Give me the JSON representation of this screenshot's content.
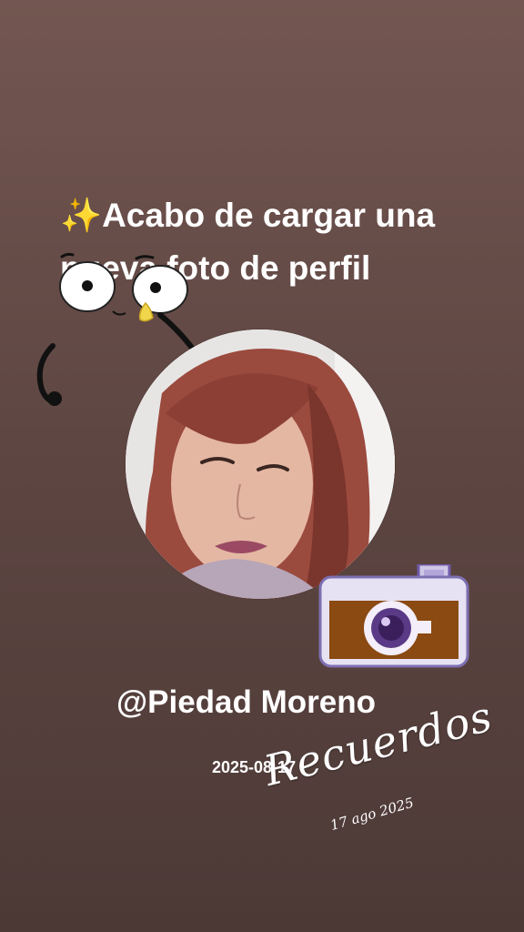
{
  "post": {
    "sparkle_icon": "sparkles-icon",
    "headline": "Acabo de cargar una nueva foto de perfil",
    "username": "@Piedad Moreno",
    "date": "2025-08-17"
  },
  "stickers": {
    "recuerdos": "Recuerdos",
    "sticker_date": "17 ago 2025",
    "camera_icon": "camera-icon",
    "face_doodle": "eyes-face-doodle"
  }
}
